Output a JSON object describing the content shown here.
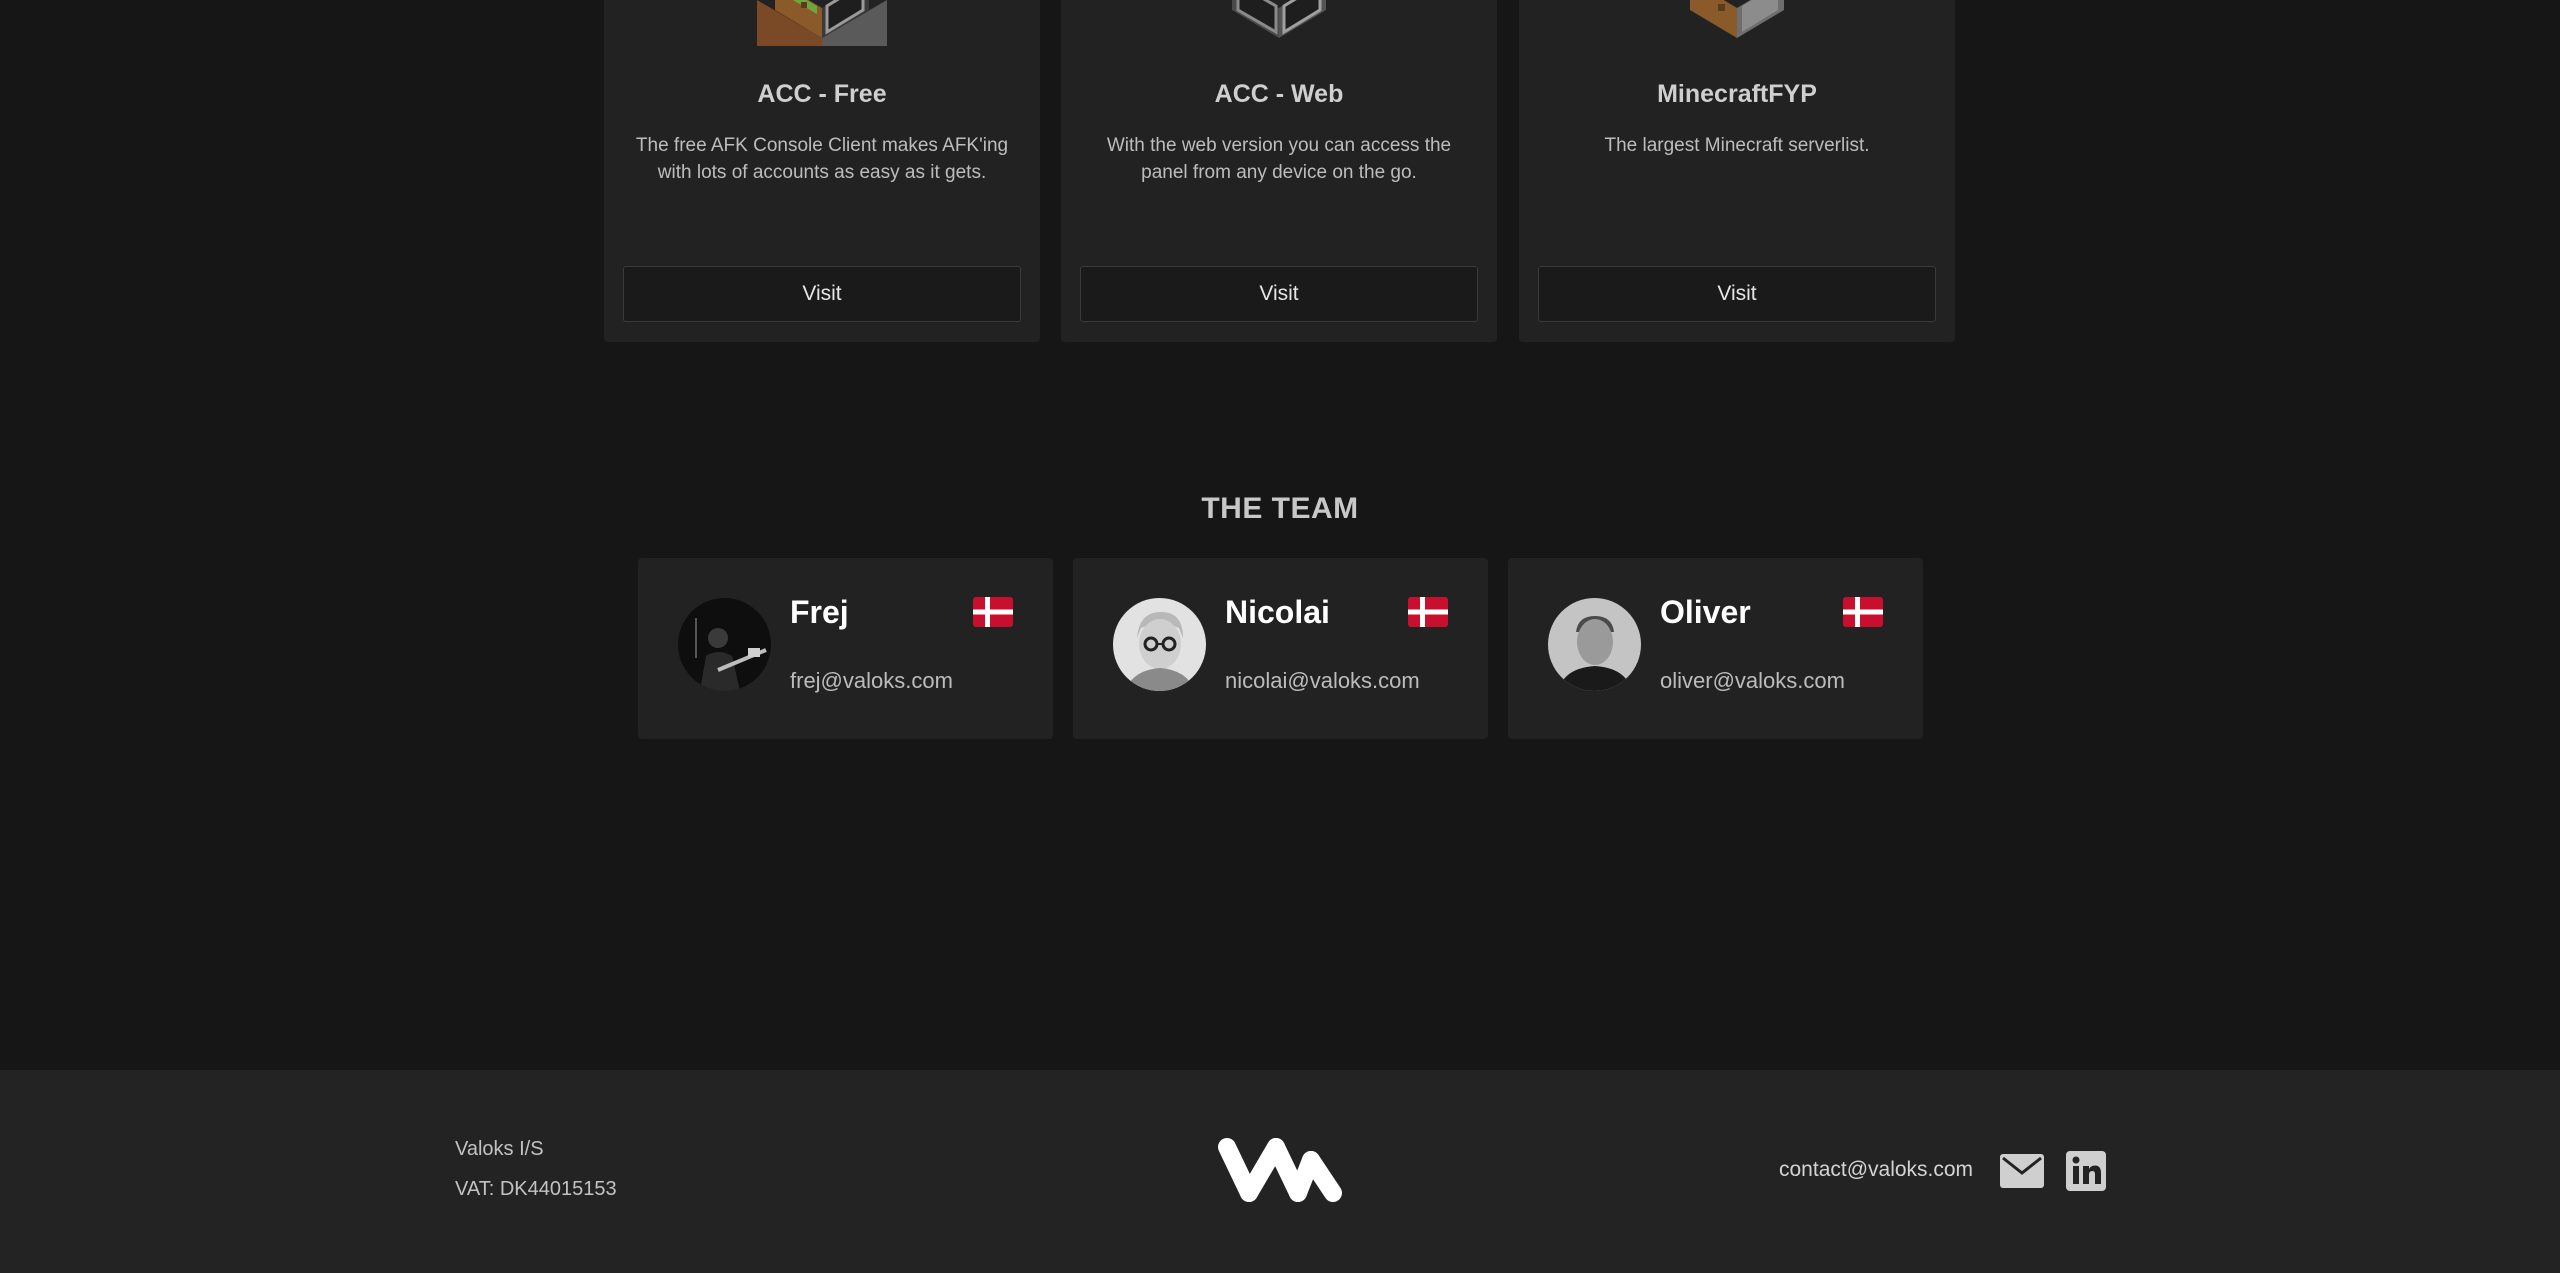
{
  "products": [
    {
      "title": "ACC - Free",
      "description": "The free AFK Console Client makes AFK'ing with lots of accounts as easy as it gets.",
      "button": "Visit",
      "icon": "dirt-block-icon"
    },
    {
      "title": "ACC - Web",
      "description": "With the web version you can access the panel from any device on the go.",
      "button": "Visit",
      "icon": "stone-block-icon"
    },
    {
      "title": "MinecraftFYP",
      "description": "The largest Minecraft serverlist.",
      "button": "Visit",
      "icon": "dirt-block-icon"
    }
  ],
  "team": {
    "title": "THE TEAM",
    "members": [
      {
        "name": "Frej",
        "email": "frej@valoks.com",
        "flag": "denmark-flag-icon"
      },
      {
        "name": "Nicolai",
        "email": "nicolai@valoks.com",
        "flag": "denmark-flag-icon"
      },
      {
        "name": "Oliver",
        "email": "oliver@valoks.com",
        "flag": "denmark-flag-icon"
      }
    ]
  },
  "footer": {
    "company": "Valoks I/S",
    "vat": "VAT: DK44015153",
    "contact_email": "contact@valoks.com",
    "icons": [
      "mail-icon",
      "linkedin-icon"
    ]
  },
  "colors": {
    "background": "#161616",
    "card": "#222222",
    "footer": "#232323",
    "flag_red": "#c8102e"
  }
}
